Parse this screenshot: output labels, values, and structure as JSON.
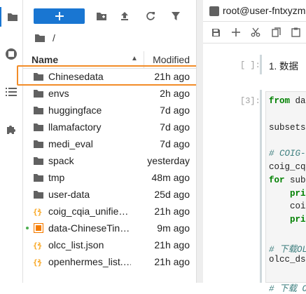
{
  "breadcrumb": {
    "path": "/"
  },
  "list_header": {
    "name": "Name",
    "modified": "Modified"
  },
  "files": [
    {
      "name": "Chinesedata",
      "modified": "21h ago",
      "kind": "folder",
      "running": false
    },
    {
      "name": "envs",
      "modified": "2h ago",
      "kind": "folder",
      "running": false
    },
    {
      "name": "huggingface",
      "modified": "7d ago",
      "kind": "folder",
      "running": false
    },
    {
      "name": "llamafactory",
      "modified": "7d ago",
      "kind": "folder",
      "running": false
    },
    {
      "name": "medi_eval",
      "modified": "7d ago",
      "kind": "folder",
      "running": false
    },
    {
      "name": "spack",
      "modified": "yesterday",
      "kind": "folder",
      "running": false
    },
    {
      "name": "tmp",
      "modified": "48m ago",
      "kind": "folder",
      "running": false
    },
    {
      "name": "user-data",
      "modified": "25d ago",
      "kind": "folder",
      "running": false
    },
    {
      "name": "coig_cqia_unifie…",
      "modified": "21h ago",
      "kind": "json",
      "running": false
    },
    {
      "name": "data-ChineseTin…",
      "modified": "9m ago",
      "kind": "notebook",
      "running": true
    },
    {
      "name": "olcc_list.json",
      "modified": "21h ago",
      "kind": "json",
      "running": false
    },
    {
      "name": "openhermes_list.…",
      "modified": "21h ago",
      "kind": "json",
      "running": false
    }
  ],
  "notebook": {
    "tab_title": "root@user-fntxyzm",
    "cells": [
      {
        "prompt": "[ ]:",
        "lines": [
          "1. 数据"
        ]
      },
      {
        "prompt": "[3]:",
        "lines": [
          "from dat",
          "",
          "subsets",
          "",
          "# COIG-C",
          "coig_cqi",
          "for subs",
          "    prin",
          "    coig",
          "    prin",
          "",
          "# 下载OL",
          "olcc_ds",
          "",
          "# 下载 O"
        ]
      }
    ]
  },
  "colors": {
    "accent": "#1976d2",
    "highlight": "#f28c28",
    "folder": "#616161",
    "json": "#f9a825",
    "notebook": "#f57c00"
  }
}
